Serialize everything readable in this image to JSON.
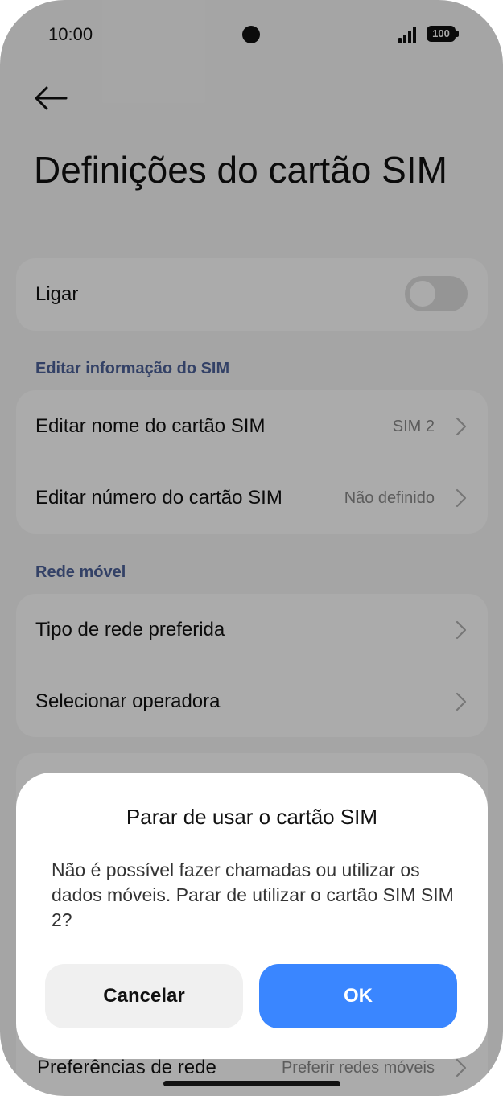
{
  "status_bar": {
    "time": "10:00",
    "battery": "100"
  },
  "header": {
    "title": "Definições do cartão SIM"
  },
  "power_card": {
    "label": "Ligar",
    "toggle_on": false
  },
  "section_edit": {
    "heading": "Editar informação do SIM",
    "items": [
      {
        "label": "Editar nome do cartão SIM",
        "value": "SIM 2"
      },
      {
        "label": "Editar número do cartão SIM",
        "value": "Não definido"
      }
    ]
  },
  "section_network": {
    "heading": "Rede móvel",
    "items": [
      {
        "label": "Tipo de rede preferida"
      },
      {
        "label": "Selecionar operadora"
      }
    ]
  },
  "bottom_item": {
    "label": "Preferências de rede",
    "value": "Preferir redes móveis"
  },
  "dialog": {
    "title": "Parar de usar o cartão SIM",
    "message": "Não é possível fazer chamadas ou utilizar os dados móveis. Parar de utilizar o cartão SIM SIM 2?",
    "cancel_label": "Cancelar",
    "ok_label": "OK"
  },
  "colors": {
    "accent": "#3a86ff",
    "section_heading": "#4d6199"
  }
}
